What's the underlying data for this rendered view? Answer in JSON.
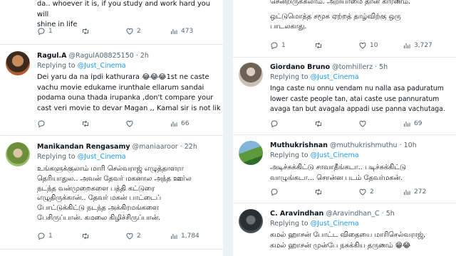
{
  "left": {
    "tweet0": {
      "body": [
        "da.. whoever it is, if you study and work hard you will",
        "shine in life"
      ],
      "counts": {
        "replies": "1",
        "likes": "2",
        "views": "473"
      }
    },
    "tweet1": {
      "name": "Ragul.A",
      "handle": "@RagulA08825150",
      "time": "· 2h",
      "reply_prefix": "Replying to",
      "reply_target": "@Just_Cinema",
      "body": [
        "Dei yaru da na ipdi kathurara 😂😂😂1st ne caste",
        "vachu movie edukame irunthale ellarum sandai",
        "podama ouna thada irupanka ,don't compare your",
        "cast veri movie to devar Magan ,, Kamal sir is not like u"
      ],
      "counts": {
        "replies": "",
        "retweets": "",
        "likes": "",
        "views": "66"
      }
    },
    "tweet2": {
      "name": "Manikandan Rengasamy",
      "handle": "@maniaaroor",
      "time": "· 22h",
      "reply_prefix": "Replying to",
      "reply_target": "@Just_Cinema",
      "body": [
        "உங்களுக்குலாம் மாரி செல்வராஜ் எழுத்தாளரா",
        "தெரியாதுல.. அவன் தேவர் மகனால அந்த ஊர்ல",
        "நடந்த வன்முறைகளை பத்தி கட்டுரை",
        "எழுதிருக்கான்.. தேவர் மகன் பாட்டைப்",
        "போட்டுக்கிட்டு நடந்த அக்கிரமங்களை",
        "பேசிருப்பான். கமலை கிழிச்சிருப்பான்."
      ],
      "counts": {
        "replies": "1",
        "likes": "2",
        "views": "1,784"
      }
    }
  },
  "right": {
    "tweet0": {
      "body": [
        "சென்றிருக்கலாம். அறியாமை தான் காரணம்.",
        "",
        "ஒட்டுமொத்த சமூக ஏற்றத் தாழ்விற்கு ஒரு",
        "பாடலகாது."
      ],
      "counts": {
        "replies": "1",
        "likes": "10",
        "views": "3,727"
      }
    },
    "tweet1": {
      "name": "Giordano Bruno",
      "handle": "@tomhillerz",
      "time": "· 5h",
      "reply_prefix": "Replying to",
      "reply_target": "@Just_Cinema",
      "body": [
        "Inga caste nu onnu vendam nu nalla asa paduratum",
        "lower caste people tan, atai caste use pannuratum",
        "avaga tan but avagala appadi use panna vachutaga."
      ],
      "counts": {
        "views": "69"
      }
    },
    "tweet2": {
      "name": "Muthukrishnan",
      "handle": "@muthukrishmuthu",
      "time": "· 10h",
      "reply_prefix": "Replying to",
      "reply_target": "@Just_Cinema",
      "body": [
        "அடிச்சுக்கிட்டு சாவாதீங்கடா.. படிச்சுக்கிட்டு",
        "வாழுங்கடா... சொன்ன படம் தேவர்மகன்."
      ],
      "counts": {
        "replies": "",
        "likes": "2",
        "views": "272"
      }
    },
    "tweet3": {
      "name": "C. Aravindhan",
      "handle": "@Aravindhan_C",
      "time": "· 5h",
      "reply_prefix": "Replying to",
      "reply_target": "@Just_Cinema",
      "body": [
        "கமல் ஹாசன் போட்ட விதையை மாரிசெல்வராஜ்,",
        "கமல் ஹாசன் முன்பே நசுக்கிய தருணம் 😁😂"
      ]
    }
  },
  "colors": {
    "link": "#1d9bf0",
    "muted": "#536471",
    "text": "#0f1419"
  }
}
